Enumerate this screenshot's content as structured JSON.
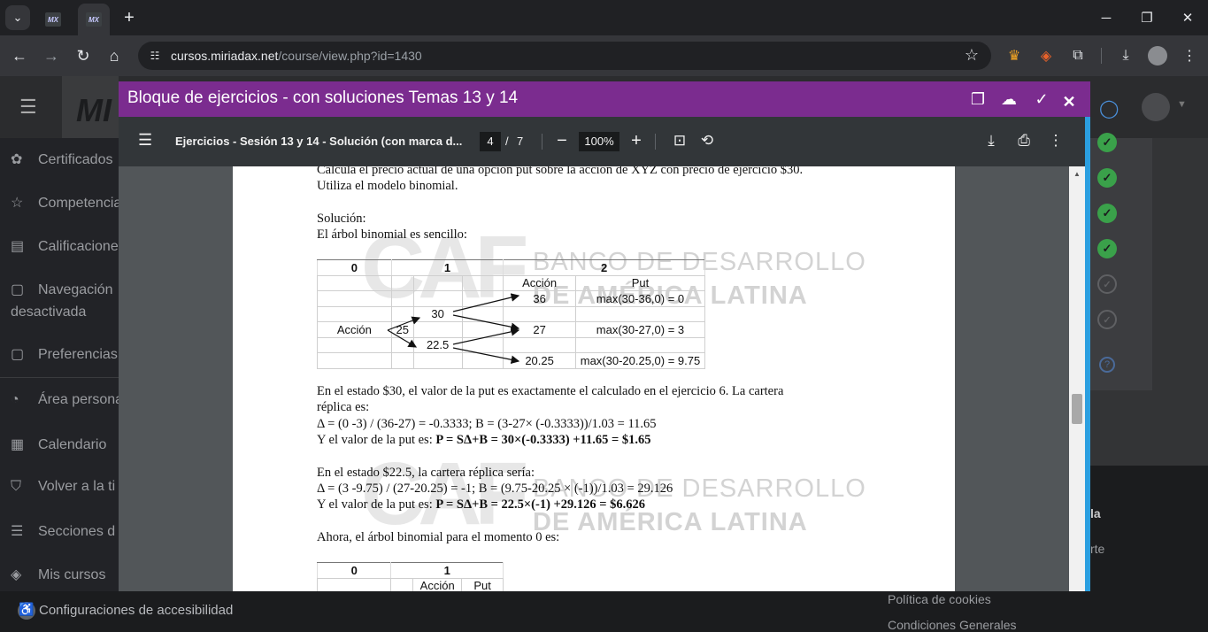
{
  "browser": {
    "tabs": [
      {
        "favicon": "MX"
      },
      {
        "favicon": "MX"
      }
    ],
    "new_tab": "+",
    "url_host": "cursos.miriadax.net",
    "url_path": "/course/view.php?id=1430"
  },
  "page": {
    "logo": "MI",
    "sidebar": [
      {
        "icon": "✿",
        "label": "Certificados"
      },
      {
        "icon": "☆",
        "label": "Competencia"
      },
      {
        "icon": "▤",
        "label": "Calificacione"
      },
      {
        "icon": "▢",
        "label": "Navegación",
        "label2": "desactivada"
      },
      {
        "icon": "▢",
        "label": "Preferencias"
      },
      {
        "icon": "◔",
        "label": "Área persona"
      },
      {
        "icon": "▦",
        "label": "Calendario"
      },
      {
        "icon": "⛉",
        "label": "Volver a la ti"
      },
      {
        "icon": "☰",
        "label": "Secciones d"
      },
      {
        "icon": "◈",
        "label": "Mis cursos"
      }
    ],
    "accessibility": "Configuraciones de accesibilidad",
    "footer_links": [
      "la",
      "rte",
      "Política de cookies",
      "Condiciones Generales"
    ],
    "progress": [
      "done",
      "done",
      "done",
      "done",
      "todo",
      "todo"
    ]
  },
  "modal": {
    "title": "Bloque de ejercicios - con soluciones Temas 13 y 14",
    "colors": {
      "title_bar": "#7b2c8f",
      "accent": "#2b9fe0"
    }
  },
  "pdf": {
    "filename": "Ejercicios - Sesión 13 y 14 - Solución (con marca d...",
    "page": "4",
    "page_separator": "/",
    "total_pages": "7",
    "zoom": "100%"
  },
  "document": {
    "intro1": "Calcula el precio actual de una opción put sobre la acción de XYZ con precio de ejercicio $30.",
    "intro2": "Utiliza el modelo binomial.",
    "sol1": "Solución:",
    "sol2": "El árbol binomial es sencillo:",
    "tree1": {
      "h0": "0",
      "h1": "1",
      "h2": "2",
      "sub_accion": "Acción",
      "sub_put": "Put",
      "r1_price": "36",
      "r1_put": "max(30-36,0) = 0",
      "r2_node": "30",
      "r3_label": "Acción",
      "r3_root": "25",
      "r3_price": "27",
      "r3_put": "max(30-27,0) = 3",
      "r4_node": "22.5",
      "r5_price": "20.25",
      "r5_put": "max(30-20.25,0) = 9.75"
    },
    "p30a": "En el estado $30, el valor de la put es exactamente el calculado en el ejercicio 6. La cartera",
    "p30b": "réplica es:",
    "p30c": "Δ = (0 -3) / (36-27) = -0.3333; B = (3-27× (-0.3333))/1.03 = 11.65",
    "p30d_plain": "Y el valor de la put es: ",
    "p30d_bold": "P = SΔ+B = 30×(-0.3333) +11.65 = $1.65",
    "p22a": "En el estado $22.5, la cartera réplica sería:",
    "p22b": "Δ = (3 -9.75) / (27-20.25) = -1; B = (9.75-20.25 × (-1))/1.03 = 29.126",
    "p22c_plain": "Y el valor de la put es: ",
    "p22c_bold": "P = SΔ+B = 22.5×(-1) +29.126 = $6.626",
    "p0": "Ahora, el árbol binomial para el momento 0 es:",
    "tree2": {
      "h0": "0",
      "h1": "1",
      "sub_accion": "Acción",
      "sub_put": "Put"
    },
    "watermark": {
      "mark": "CAF",
      "line1": "BANCO DE DESARROLLO",
      "line2": "DE AMÉRICA LATINA"
    }
  }
}
